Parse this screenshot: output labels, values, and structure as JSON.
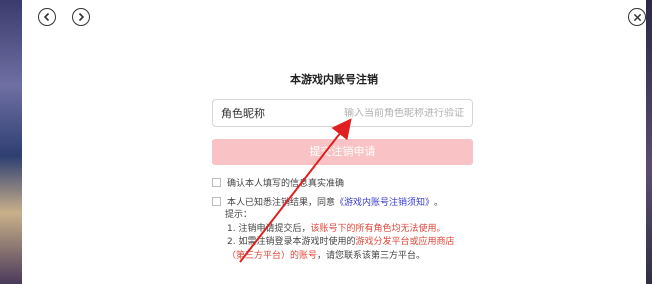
{
  "dialog": {
    "title": "本游戏内账号注销",
    "nickname_label": "角色昵称",
    "nickname_placeholder": "输入当前角色昵称进行验证",
    "nickname_value": "",
    "submit_label": "提交注销申请"
  },
  "agreements": {
    "confirm_text": "确认本人填写的信息真实准确",
    "agree_prefix": "本人已知悉注销结果，同意",
    "agree_link": "《游戏内账号注销须知》",
    "agree_suffix": "。"
  },
  "notes": {
    "heading": "提示：",
    "item1_prefix": "1. 注销申请提交后，",
    "item1_red": "该账号下的所有角色均无法使用。",
    "item2_prefix": "2. 如需注销登录本游戏时使用的",
    "item2_red1": "游戏分发平台或应用商店",
    "item2_red2": "（第三方平台）的账号",
    "item2_suffix": "，请您联系该第三方平台。"
  },
  "icons": {
    "back": "chevron-left-icon",
    "forward": "chevron-right-icon",
    "close": "close-icon"
  },
  "colors": {
    "submit_bg": "#f9c2c4",
    "link": "#3a3ad0",
    "warning": "#e0463a",
    "annotation_arrow": "#e02020"
  }
}
